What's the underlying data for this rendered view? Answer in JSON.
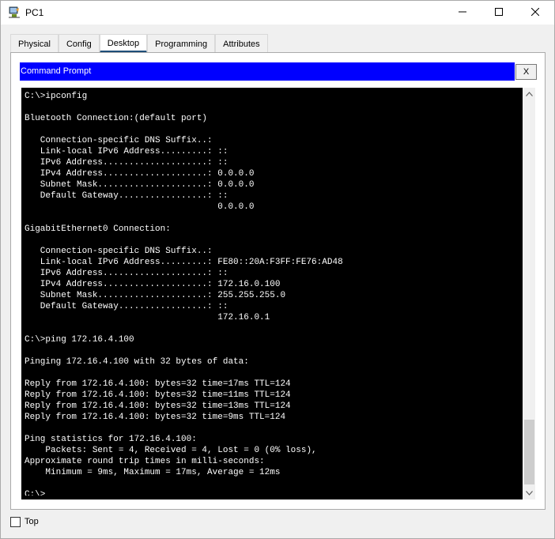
{
  "window": {
    "title": "PC1"
  },
  "tabs": [
    {
      "label": "Physical"
    },
    {
      "label": "Config"
    },
    {
      "label": "Desktop"
    },
    {
      "label": "Programming"
    },
    {
      "label": "Attributes"
    }
  ],
  "active_tab": "Desktop",
  "cmd": {
    "title": "Command Prompt",
    "close_label": "X",
    "output": "C:\\>ipconfig\n\nBluetooth Connection:(default port)\n\n   Connection-specific DNS Suffix..: \n   Link-local IPv6 Address.........: ::\n   IPv6 Address....................: ::\n   IPv4 Address....................: 0.0.0.0\n   Subnet Mask.....................: 0.0.0.0\n   Default Gateway.................: ::\n                                     0.0.0.0\n\nGigabitEthernet0 Connection:\n\n   Connection-specific DNS Suffix..: \n   Link-local IPv6 Address.........: FE80::20A:F3FF:FE76:AD48\n   IPv6 Address....................: ::\n   IPv4 Address....................: 172.16.0.100\n   Subnet Mask.....................: 255.255.255.0\n   Default Gateway.................: ::\n                                     172.16.0.1\n\nC:\\>ping 172.16.4.100\n\nPinging 172.16.4.100 with 32 bytes of data:\n\nReply from 172.16.4.100: bytes=32 time=17ms TTL=124\nReply from 172.16.4.100: bytes=32 time=11ms TTL=124\nReply from 172.16.4.100: bytes=32 time=13ms TTL=124\nReply from 172.16.4.100: bytes=32 time=9ms TTL=124\n\nPing statistics for 172.16.4.100:\n    Packets: Sent = 4, Received = 4, Lost = 0 (0% loss),\nApproximate round trip times in milli-seconds:\n    Minimum = 9ms, Maximum = 17ms, Average = 12ms\n\nC:\\>"
  },
  "footer": {
    "top_label": "Top"
  },
  "icons": {
    "app": "packet-tracer-pc-icon",
    "minimize": "minimize-icon",
    "maximize": "maximize-icon",
    "close": "close-icon",
    "scroll_up": "scroll-up-arrow-icon",
    "scroll_down": "scroll-down-arrow-icon"
  },
  "colors": {
    "cmd_header": "#0000ff",
    "terminal_bg": "#000000",
    "terminal_fg": "#ffffff",
    "active_tab_underline": "#1f4e79"
  }
}
